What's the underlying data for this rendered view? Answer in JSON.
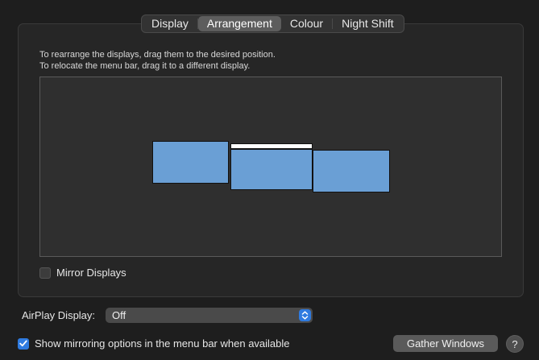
{
  "tabs": [
    {
      "label": "Display",
      "selected": false
    },
    {
      "label": "Arrangement",
      "selected": true
    },
    {
      "label": "Colour",
      "selected": false
    },
    {
      "label": "Night Shift",
      "selected": false
    }
  ],
  "instructions": {
    "line1": "To rearrange the displays, drag them to the desired position.",
    "line2": "To relocate the menu bar, drag it to a different display."
  },
  "arrangement": {
    "display_count": 3,
    "menu_bar_on_display": 2,
    "display_color": "#6a9fd5"
  },
  "mirror_displays": {
    "label": "Mirror Displays",
    "checked": false
  },
  "airplay": {
    "label": "AirPlay Display:",
    "value": "Off"
  },
  "show_mirroring": {
    "label": "Show mirroring options in the menu bar when available",
    "checked": true
  },
  "buttons": {
    "gather_windows": "Gather Windows",
    "help": "?"
  },
  "colors": {
    "accent": "#2f7be0",
    "background": "#1e1e1e"
  },
  "icons": {
    "checkmark": "checkmark-icon",
    "select_arrows": "chevron-up-down-icon",
    "help": "question-mark-icon"
  }
}
